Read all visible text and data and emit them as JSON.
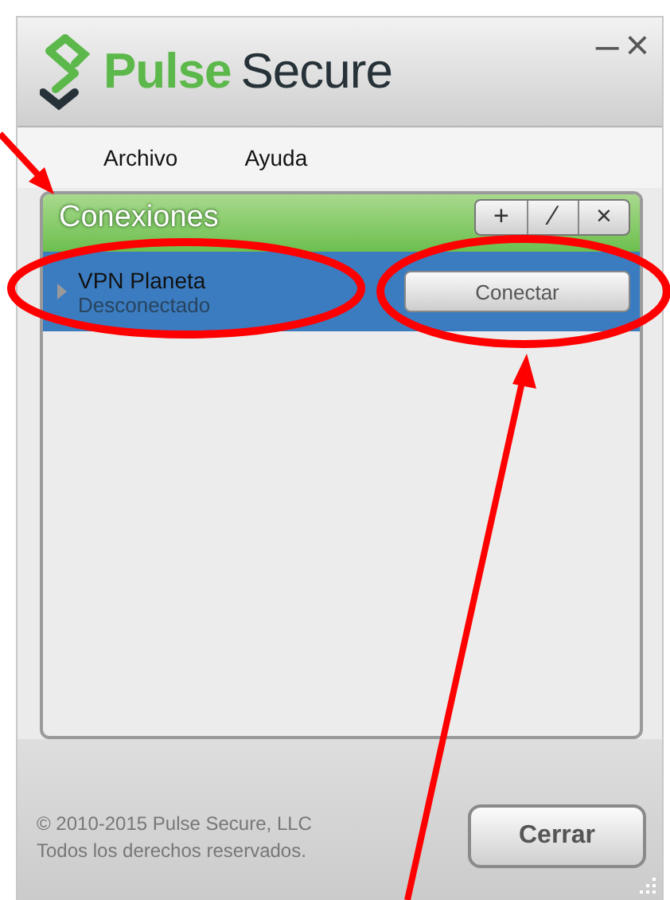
{
  "window": {
    "logo_text_1": "Pulse",
    "logo_text_2": "Secure",
    "minimize": "–",
    "close": "×"
  },
  "menu": [
    "Archivo",
    "Ayuda"
  ],
  "connections": {
    "title": "Conexiones",
    "tools": [
      "+",
      "⁄",
      "×"
    ],
    "items": [
      {
        "name": "VPN Planeta",
        "status": "Desconectado",
        "selected": true,
        "expanded": false,
        "action": "Conectar"
      }
    ]
  },
  "footer": {
    "copyright": "© 2010-2015 Pulse Secure, LLC",
    "rights": "Todos los derechos reservados.",
    "button": "Cerrar"
  }
}
